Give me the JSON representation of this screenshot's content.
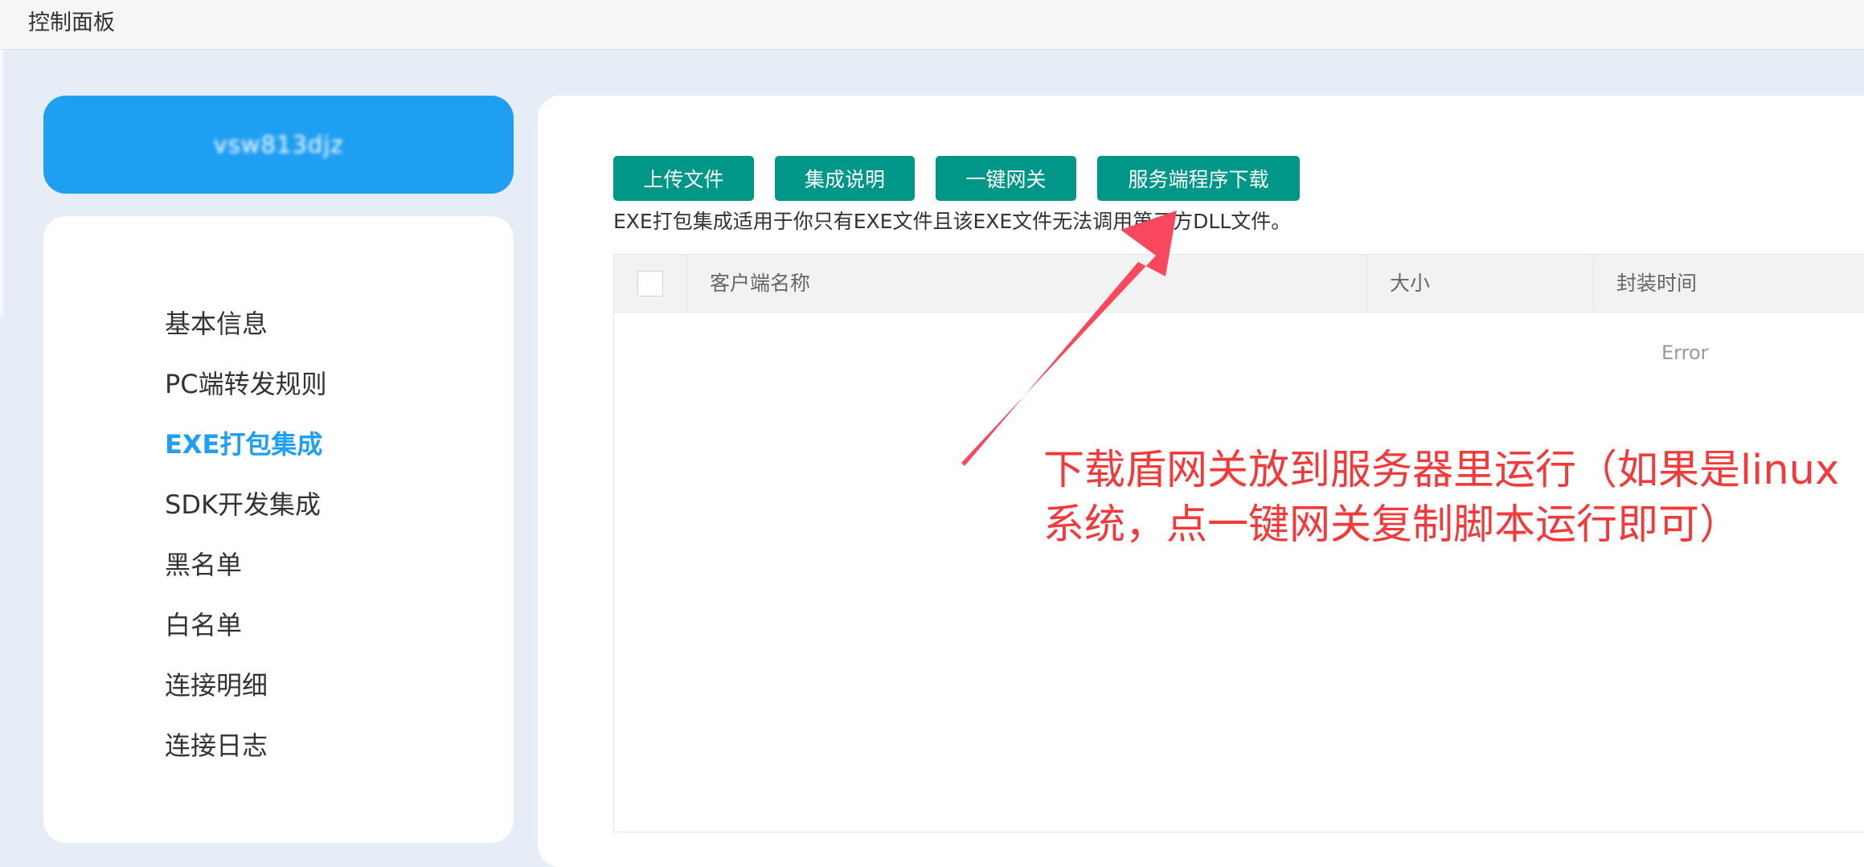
{
  "header": {
    "title": "控制面板"
  },
  "user": {
    "name": "vsw813djz"
  },
  "sidebar": {
    "items": [
      {
        "label": "基本信息",
        "active": false
      },
      {
        "label": "PC端转发规则",
        "active": false
      },
      {
        "label": "EXE打包集成",
        "active": true
      },
      {
        "label": "SDK开发集成",
        "active": false
      },
      {
        "label": "黑名单",
        "active": false
      },
      {
        "label": "白名单",
        "active": false
      },
      {
        "label": "连接明细",
        "active": false
      },
      {
        "label": "连接日志",
        "active": false
      }
    ]
  },
  "toolbar": {
    "upload_label": "上传文件",
    "guide_label": "集成说明",
    "gateway_label": "一键网关",
    "download_label": "服务端程序下载"
  },
  "hint": "EXE打包集成适用于你只有EXE文件且该EXE文件无法调用第三方DLL文件。",
  "table": {
    "columns": [
      "客户端名称",
      "大小",
      "封装时间"
    ],
    "empty_text": "Error"
  },
  "annotation": {
    "line1": "下载盾网关放到服务器里运行（如果是linux",
    "line2": "系统，点一键网关复制脚本运行即可）"
  },
  "colors": {
    "accent": "#1e9ff2",
    "button": "#009688",
    "annotation": "#f23a3a"
  }
}
